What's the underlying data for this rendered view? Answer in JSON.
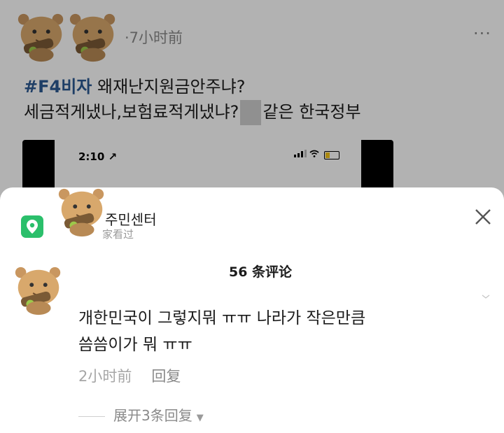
{
  "post": {
    "time": "·7小时前",
    "more_label": "···",
    "hashtag": "#F4비자",
    "line1_rest": " 왜재난지원금안주냐?",
    "line2_before": "세금적게냈나,보험료적게냈냐?",
    "line2_after": "같은 한국정부",
    "embedded_status_time": "2:10 ↗"
  },
  "sheet": {
    "place_name": "주민센터",
    "place_sub": "家看过",
    "comment_count": "56 条评论",
    "comment": {
      "text_line1": "개한민국이 그렇지뭐 ㅠㅠ 나라가 작은만큼",
      "text_line2": "씀씀이가 뭐 ㅠㅠ",
      "time": "2小时前",
      "reply_label": "回复"
    },
    "expand_label": "展开3条回复"
  },
  "icons": {
    "location": "location-pin-icon",
    "close": "close-icon",
    "more": "more-dots-icon",
    "expand": "chevron-down-icon",
    "like": "heart-icon"
  },
  "colors": {
    "hashtag": "#2b5a93",
    "location_badge": "#2bbf6b",
    "meta_text": "#a6a6a6"
  }
}
